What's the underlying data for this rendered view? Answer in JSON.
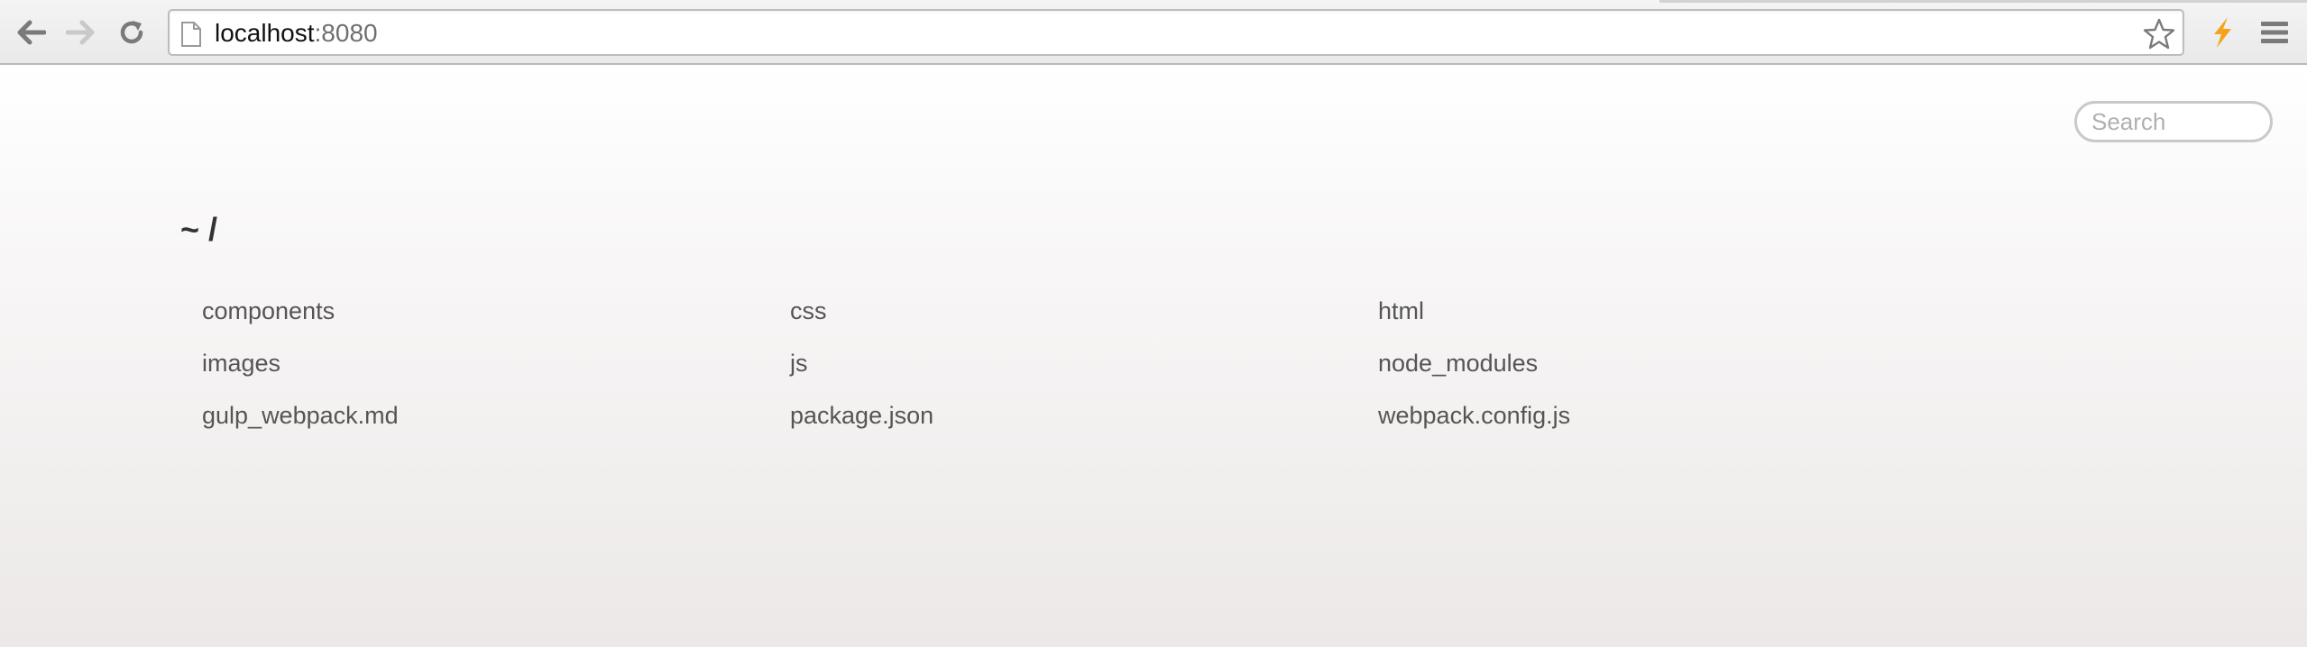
{
  "browser": {
    "url_host": "localhost",
    "url_port": ":8080",
    "back_icon": "arrow-left-icon",
    "forward_icon": "arrow-right-icon",
    "reload_icon": "reload-icon",
    "page_icon": "document-icon",
    "star_icon": "star-outline-icon",
    "extension_icon": "lightning-bolt-icon",
    "menu_icon": "hamburger-menu-icon",
    "extension_color": "#f4a31c"
  },
  "page": {
    "search_placeholder": "Search",
    "breadcrumb": "~ /",
    "files": [
      "components",
      "css",
      "html",
      "images",
      "js",
      "node_modules",
      "gulp_webpack.md",
      "package.json",
      "webpack.config.js"
    ]
  }
}
